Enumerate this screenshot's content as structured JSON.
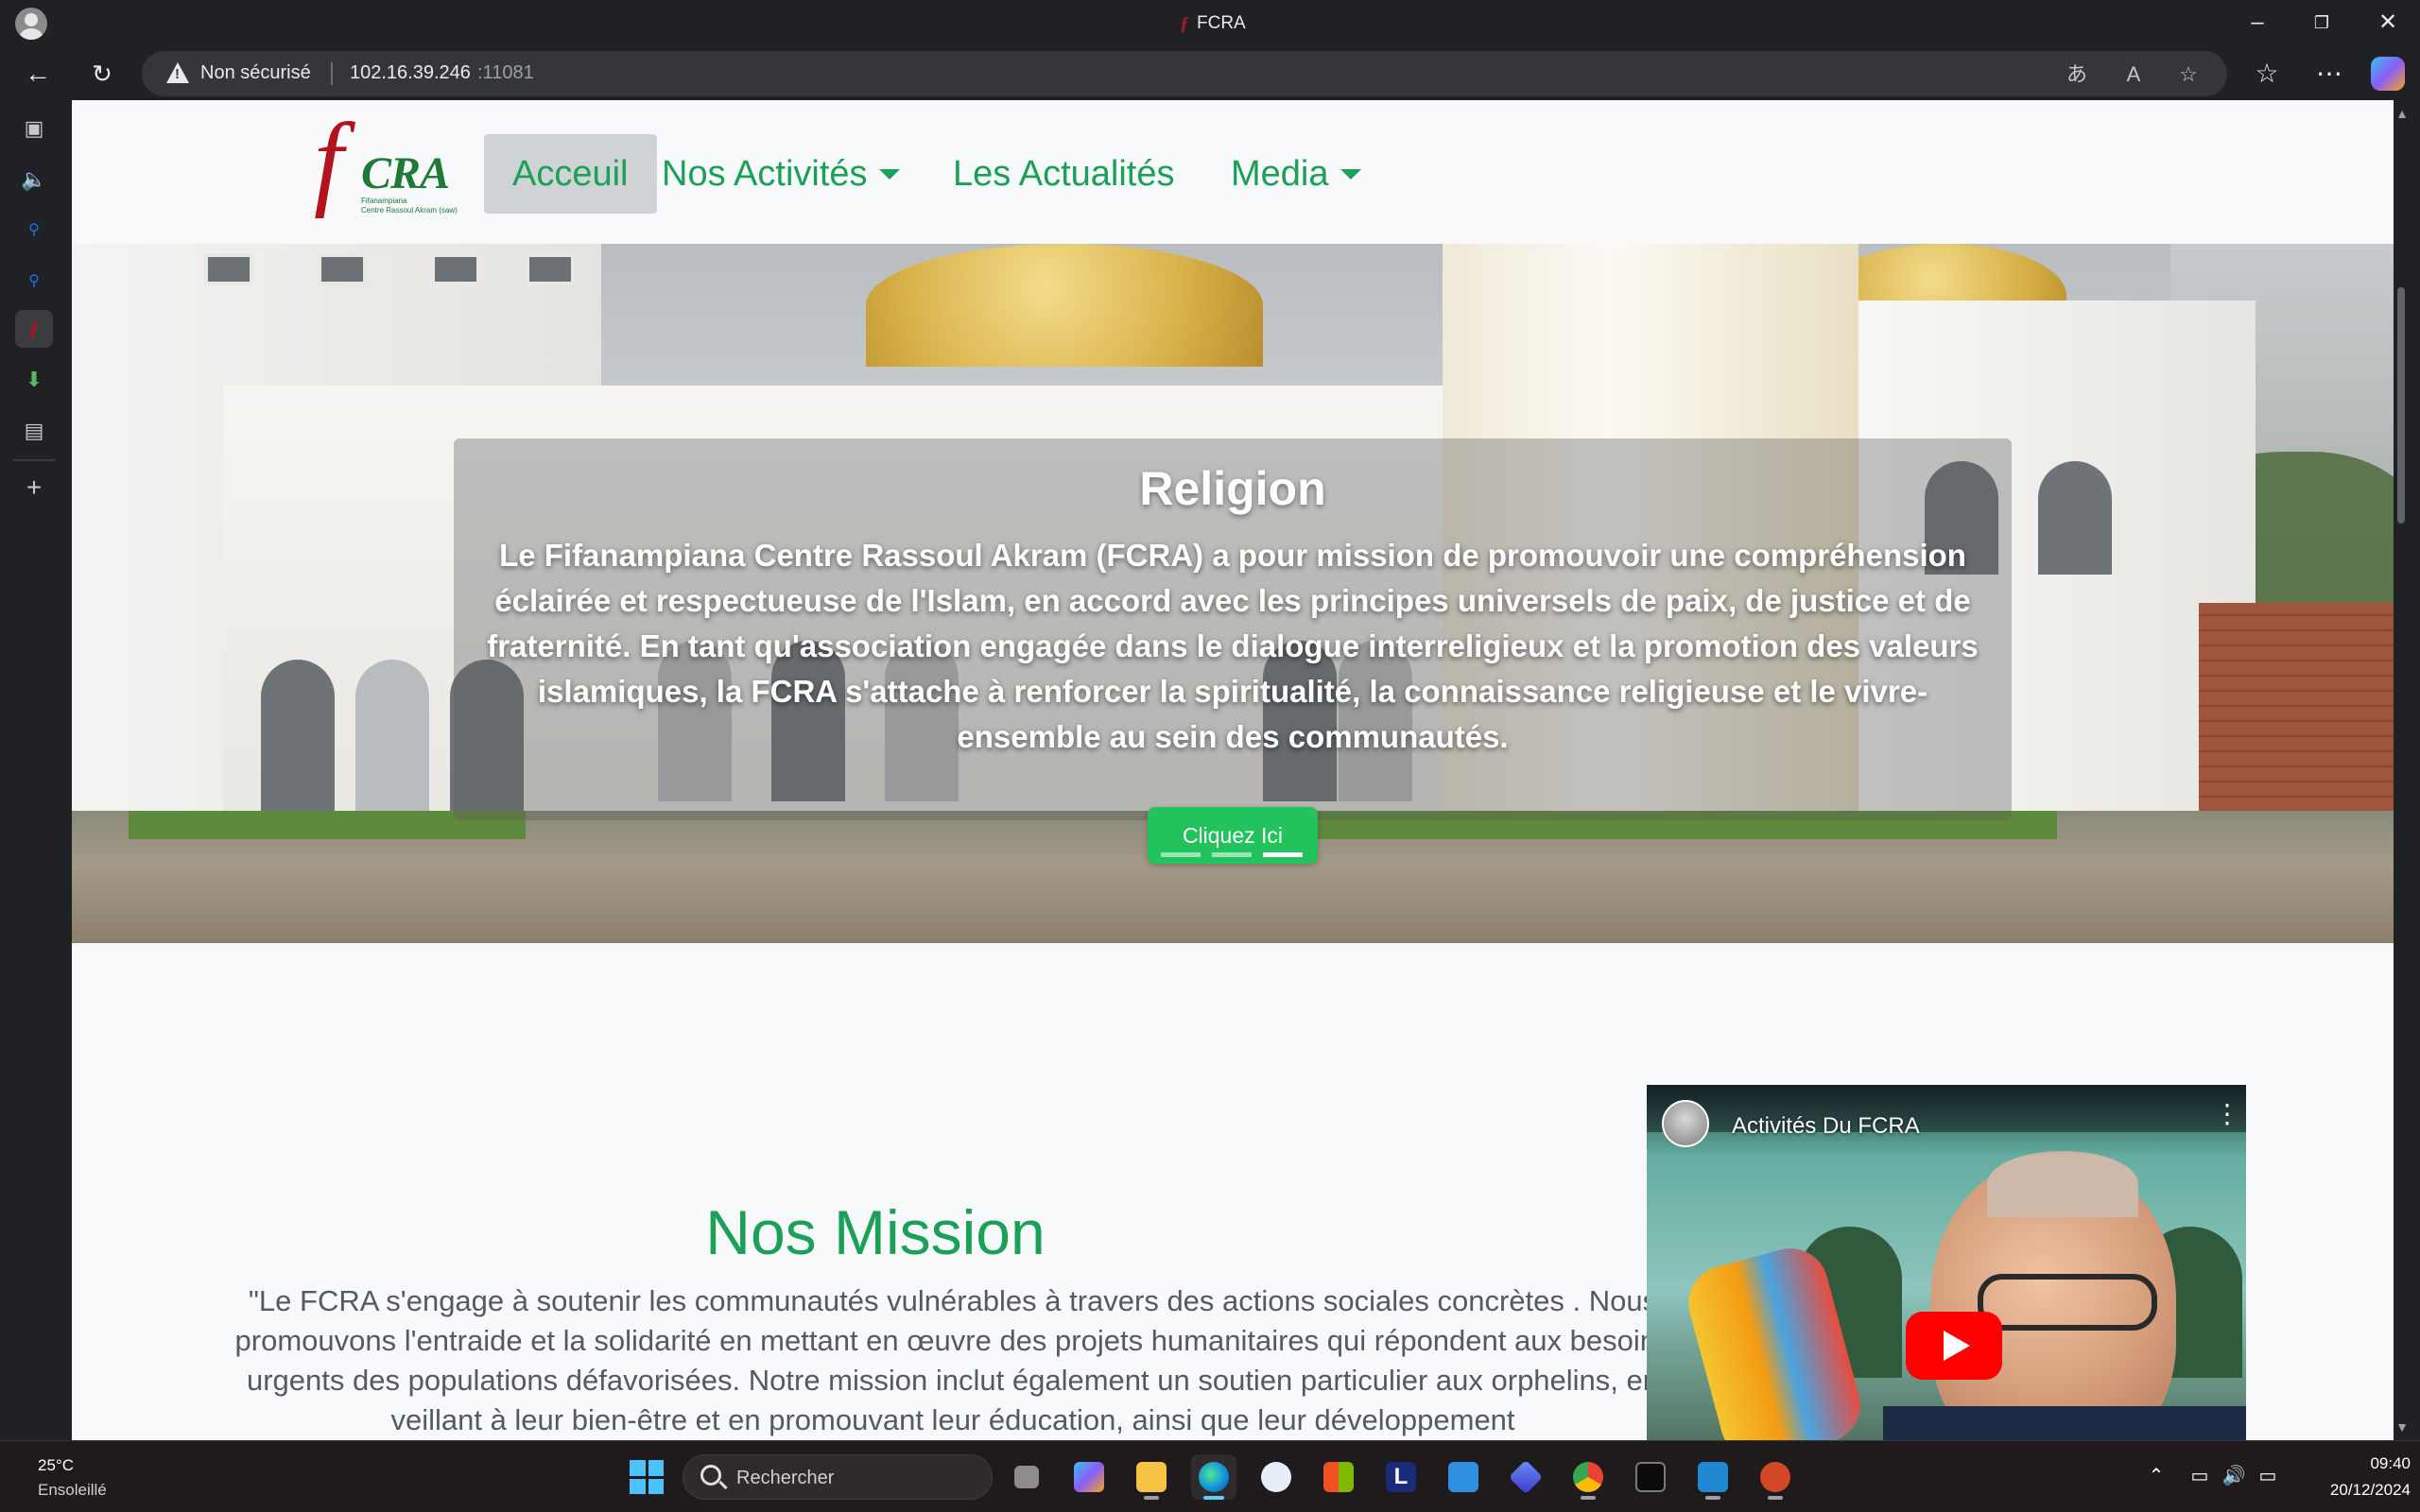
{
  "browser": {
    "tab_title": "FCRA",
    "tab_favicon": "FCRA",
    "security_label": "Non sécurisé",
    "url_host": "102.16.39.246",
    "url_port": ":11081",
    "icons": {
      "back": "arrow-left",
      "refresh": "refresh",
      "warning": "warning-triangle",
      "translate": "translate",
      "read_aloud": "read-aloud",
      "favorite": "star",
      "favorites": "favorites-bar",
      "menu": "ellipsis",
      "copilot": "copilot"
    }
  },
  "sidebar": {
    "items": [
      "tabs-icon",
      "speaker-icon",
      "search-icon",
      "search-icon",
      "fcra-favicon",
      "download-icon",
      "collection-icon",
      "add-icon"
    ]
  },
  "site": {
    "logo": {
      "letter": "f",
      "name": "CRA",
      "subtitle_line1": "Fifanampiana",
      "subtitle_line2": "Centre Rassoul Akram (saw)"
    },
    "nav": [
      {
        "label": "Acceuil",
        "active": true,
        "dropdown": false
      },
      {
        "label": "Nos Activités",
        "active": false,
        "dropdown": true
      },
      {
        "label": "Les Actualités",
        "active": false,
        "dropdown": false
      },
      {
        "label": "Media",
        "active": false,
        "dropdown": true
      }
    ],
    "colors": {
      "accent": "#1aa057",
      "button": "#22c35c",
      "brand_red": "#b3121f"
    }
  },
  "hero": {
    "title": "Religion",
    "text": "Le Fifanampiana Centre Rassoul Akram (FCRA) a pour mission de promouvoir une compréhension éclairée et respectueuse de l'Islam, en accord avec les principes universels de paix, de justice et de fraternité. En tant qu'association engagée dans le dialogue interreligieux et la promotion des valeurs islamiques, la FCRA s'attache à renforcer la spiritualité, la connaissance religieuse et le vivre-ensemble au sein des communautés.",
    "button_label": "Cliquez Ici",
    "slide_count": 3,
    "active_slide": 3
  },
  "mission": {
    "title": "Nos Mission",
    "text": "\"Le FCRA s'engage à soutenir les communautés vulnérables à travers des actions sociales concrètes . Nous promouvons l'entraide et la solidarité en mettant en œuvre des projets humanitaires qui répondent aux besoins urgents des populations défavorisées. Notre mission inclut également un soutien particulier aux orphelins, en veillant à leur bien-être et en promouvant leur éducation, ainsi que leur développement"
  },
  "video": {
    "title": "Activités Du FCRA",
    "play_icon": "youtube-play-icon",
    "menu_icon": "vertical-ellipsis-icon"
  },
  "taskbar": {
    "weather_temp": "25°C",
    "weather_desc": "Ensoleillé",
    "search_placeholder": "Rechercher",
    "apps": [
      "task-view",
      "copilot",
      "file-explorer",
      "edge",
      "app-store-a",
      "microsoft-store",
      "l-app",
      "pen-app",
      "power-automate",
      "chrome",
      "terminal",
      "vscode",
      "powerpoint"
    ],
    "time": "09:40",
    "date": "20/12/2024"
  }
}
